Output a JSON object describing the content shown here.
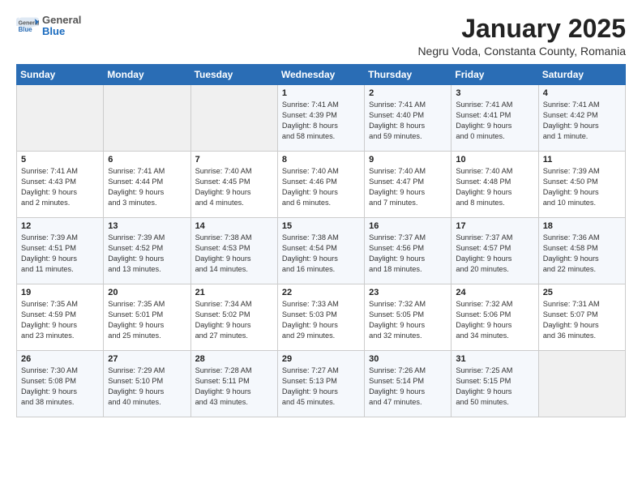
{
  "logo": {
    "general": "General",
    "blue": "Blue"
  },
  "title": "January 2025",
  "location": "Negru Voda, Constanta County, Romania",
  "weekdays": [
    "Sunday",
    "Monday",
    "Tuesday",
    "Wednesday",
    "Thursday",
    "Friday",
    "Saturday"
  ],
  "weeks": [
    [
      {
        "day": "",
        "info": ""
      },
      {
        "day": "",
        "info": ""
      },
      {
        "day": "",
        "info": ""
      },
      {
        "day": "1",
        "info": "Sunrise: 7:41 AM\nSunset: 4:39 PM\nDaylight: 8 hours\nand 58 minutes."
      },
      {
        "day": "2",
        "info": "Sunrise: 7:41 AM\nSunset: 4:40 PM\nDaylight: 8 hours\nand 59 minutes."
      },
      {
        "day": "3",
        "info": "Sunrise: 7:41 AM\nSunset: 4:41 PM\nDaylight: 9 hours\nand 0 minutes."
      },
      {
        "day": "4",
        "info": "Sunrise: 7:41 AM\nSunset: 4:42 PM\nDaylight: 9 hours\nand 1 minute."
      }
    ],
    [
      {
        "day": "5",
        "info": "Sunrise: 7:41 AM\nSunset: 4:43 PM\nDaylight: 9 hours\nand 2 minutes."
      },
      {
        "day": "6",
        "info": "Sunrise: 7:41 AM\nSunset: 4:44 PM\nDaylight: 9 hours\nand 3 minutes."
      },
      {
        "day": "7",
        "info": "Sunrise: 7:40 AM\nSunset: 4:45 PM\nDaylight: 9 hours\nand 4 minutes."
      },
      {
        "day": "8",
        "info": "Sunrise: 7:40 AM\nSunset: 4:46 PM\nDaylight: 9 hours\nand 6 minutes."
      },
      {
        "day": "9",
        "info": "Sunrise: 7:40 AM\nSunset: 4:47 PM\nDaylight: 9 hours\nand 7 minutes."
      },
      {
        "day": "10",
        "info": "Sunrise: 7:40 AM\nSunset: 4:48 PM\nDaylight: 9 hours\nand 8 minutes."
      },
      {
        "day": "11",
        "info": "Sunrise: 7:39 AM\nSunset: 4:50 PM\nDaylight: 9 hours\nand 10 minutes."
      }
    ],
    [
      {
        "day": "12",
        "info": "Sunrise: 7:39 AM\nSunset: 4:51 PM\nDaylight: 9 hours\nand 11 minutes."
      },
      {
        "day": "13",
        "info": "Sunrise: 7:39 AM\nSunset: 4:52 PM\nDaylight: 9 hours\nand 13 minutes."
      },
      {
        "day": "14",
        "info": "Sunrise: 7:38 AM\nSunset: 4:53 PM\nDaylight: 9 hours\nand 14 minutes."
      },
      {
        "day": "15",
        "info": "Sunrise: 7:38 AM\nSunset: 4:54 PM\nDaylight: 9 hours\nand 16 minutes."
      },
      {
        "day": "16",
        "info": "Sunrise: 7:37 AM\nSunset: 4:56 PM\nDaylight: 9 hours\nand 18 minutes."
      },
      {
        "day": "17",
        "info": "Sunrise: 7:37 AM\nSunset: 4:57 PM\nDaylight: 9 hours\nand 20 minutes."
      },
      {
        "day": "18",
        "info": "Sunrise: 7:36 AM\nSunset: 4:58 PM\nDaylight: 9 hours\nand 22 minutes."
      }
    ],
    [
      {
        "day": "19",
        "info": "Sunrise: 7:35 AM\nSunset: 4:59 PM\nDaylight: 9 hours\nand 23 minutes."
      },
      {
        "day": "20",
        "info": "Sunrise: 7:35 AM\nSunset: 5:01 PM\nDaylight: 9 hours\nand 25 minutes."
      },
      {
        "day": "21",
        "info": "Sunrise: 7:34 AM\nSunset: 5:02 PM\nDaylight: 9 hours\nand 27 minutes."
      },
      {
        "day": "22",
        "info": "Sunrise: 7:33 AM\nSunset: 5:03 PM\nDaylight: 9 hours\nand 29 minutes."
      },
      {
        "day": "23",
        "info": "Sunrise: 7:32 AM\nSunset: 5:05 PM\nDaylight: 9 hours\nand 32 minutes."
      },
      {
        "day": "24",
        "info": "Sunrise: 7:32 AM\nSunset: 5:06 PM\nDaylight: 9 hours\nand 34 minutes."
      },
      {
        "day": "25",
        "info": "Sunrise: 7:31 AM\nSunset: 5:07 PM\nDaylight: 9 hours\nand 36 minutes."
      }
    ],
    [
      {
        "day": "26",
        "info": "Sunrise: 7:30 AM\nSunset: 5:08 PM\nDaylight: 9 hours\nand 38 minutes."
      },
      {
        "day": "27",
        "info": "Sunrise: 7:29 AM\nSunset: 5:10 PM\nDaylight: 9 hours\nand 40 minutes."
      },
      {
        "day": "28",
        "info": "Sunrise: 7:28 AM\nSunset: 5:11 PM\nDaylight: 9 hours\nand 43 minutes."
      },
      {
        "day": "29",
        "info": "Sunrise: 7:27 AM\nSunset: 5:13 PM\nDaylight: 9 hours\nand 45 minutes."
      },
      {
        "day": "30",
        "info": "Sunrise: 7:26 AM\nSunset: 5:14 PM\nDaylight: 9 hours\nand 47 minutes."
      },
      {
        "day": "31",
        "info": "Sunrise: 7:25 AM\nSunset: 5:15 PM\nDaylight: 9 hours\nand 50 minutes."
      },
      {
        "day": "",
        "info": ""
      }
    ]
  ]
}
